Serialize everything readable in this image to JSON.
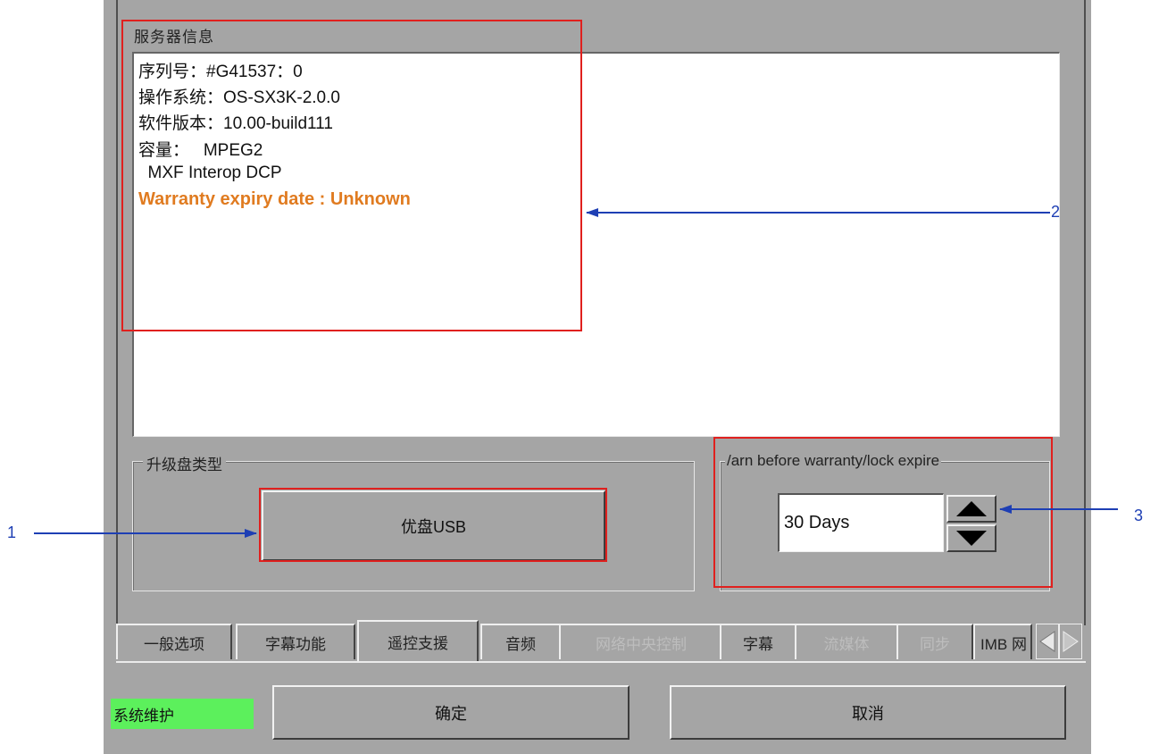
{
  "server_info": {
    "title": "服务器信息",
    "lines": [
      "序列号：#G41537：0",
      "操作系统：OS-SX3K-2.0.0",
      "软件版本：10.00-build111",
      "容量：   MPEG2",
      "  MXF Interop DCP"
    ],
    "warranty": "Warranty expiry date : Unknown"
  },
  "upgrade_disk": {
    "label": "升级盘类型",
    "button": "优盘USB"
  },
  "warn_expire": {
    "label": "/arn before warranty/lock expire",
    "value": "30  Days"
  },
  "tabs": [
    {
      "label": "一般选项",
      "state": "normal"
    },
    {
      "label": "字幕功能",
      "state": "normal"
    },
    {
      "label": "遥控支援",
      "state": "active"
    },
    {
      "label": "音频",
      "state": "normal"
    },
    {
      "label": "网络中央控制",
      "state": "disabled"
    },
    {
      "label": "字幕",
      "state": "normal"
    },
    {
      "label": "流媒体",
      "state": "disabled"
    },
    {
      "label": "同步",
      "state": "disabled"
    },
    {
      "label": "IMB 网",
      "state": "normal"
    }
  ],
  "footer": {
    "status": "系统维护",
    "ok": "确定",
    "cancel": "取消"
  },
  "annotations": [
    "1",
    "2",
    "3"
  ],
  "colors": {
    "dialog_bg": "#a5a5a5",
    "warning_text": "#e07b20",
    "status_green": "#5cf05c",
    "annotation_red": "#e0201e",
    "annotation_blue": "#1e3fb4"
  }
}
